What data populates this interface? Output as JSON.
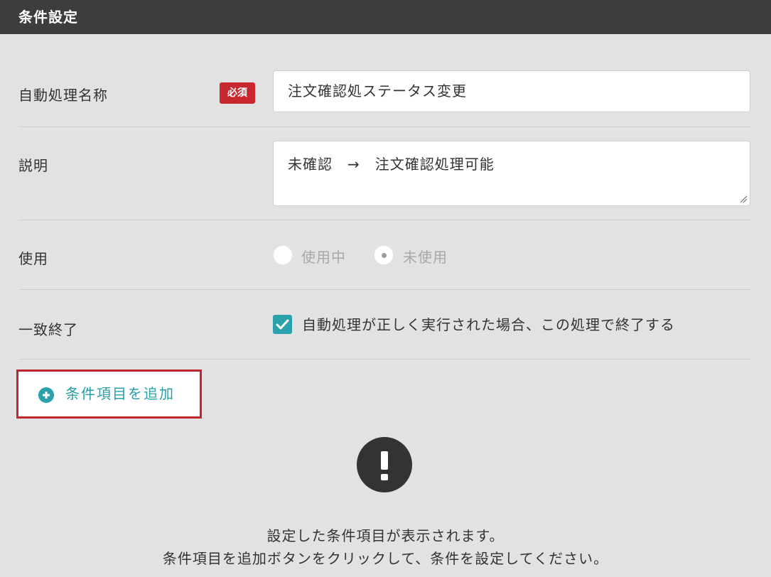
{
  "header": {
    "title": "条件設定"
  },
  "form": {
    "name": {
      "label": "自動処理名称",
      "required_badge": "必須",
      "value": "注文確認処ステータス変更"
    },
    "description": {
      "label": "説明",
      "value": "未確認　→　注文確認処理可能"
    },
    "usage": {
      "label": "使用",
      "options": [
        {
          "label": "使用中",
          "selected": false
        },
        {
          "label": "未使用",
          "selected": true
        }
      ]
    },
    "match_end": {
      "label": "一致終了",
      "checkbox_label": "自動処理が正しく実行された場合、この処理で終了する",
      "checked": true
    }
  },
  "add_condition": {
    "label": "条件項目を追加",
    "icon": "plus-circle-icon"
  },
  "empty_state": {
    "icon": "exclamation-circle-icon",
    "line1": "設定した条件項目が表示されます。",
    "line2": "条件項目を追加ボタンをクリックして、条件を設定してください。"
  },
  "colors": {
    "header_bg": "#3d3d3d",
    "accent": "#2aa1ab",
    "required": "#c8282d",
    "highlight_border": "#c0262d",
    "background": "#e2e2e2"
  }
}
